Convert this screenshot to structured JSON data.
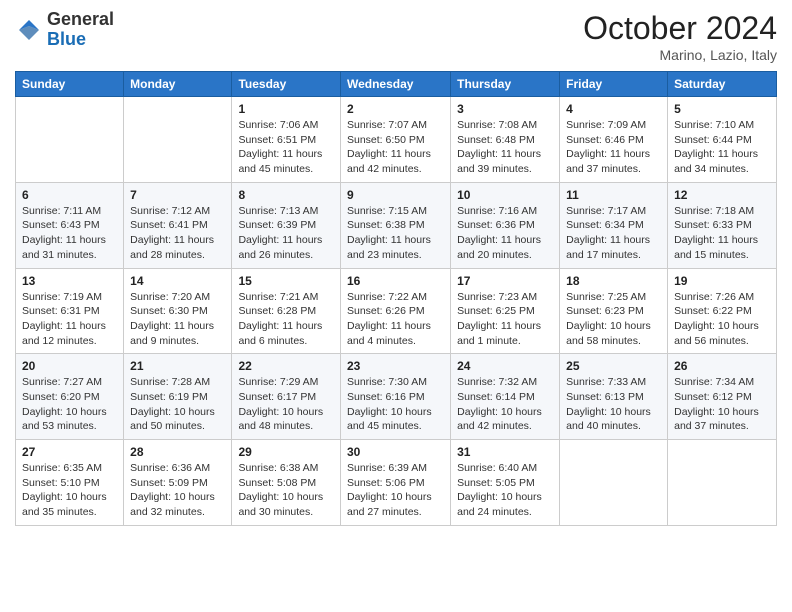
{
  "header": {
    "logo_general": "General",
    "logo_blue": "Blue",
    "month_title": "October 2024",
    "location": "Marino, Lazio, Italy"
  },
  "days_of_week": [
    "Sunday",
    "Monday",
    "Tuesday",
    "Wednesday",
    "Thursday",
    "Friday",
    "Saturday"
  ],
  "weeks": [
    [
      {
        "day": "",
        "info": ""
      },
      {
        "day": "",
        "info": ""
      },
      {
        "day": "1",
        "info": "Sunrise: 7:06 AM\nSunset: 6:51 PM\nDaylight: 11 hours and 45 minutes."
      },
      {
        "day": "2",
        "info": "Sunrise: 7:07 AM\nSunset: 6:50 PM\nDaylight: 11 hours and 42 minutes."
      },
      {
        "day": "3",
        "info": "Sunrise: 7:08 AM\nSunset: 6:48 PM\nDaylight: 11 hours and 39 minutes."
      },
      {
        "day": "4",
        "info": "Sunrise: 7:09 AM\nSunset: 6:46 PM\nDaylight: 11 hours and 37 minutes."
      },
      {
        "day": "5",
        "info": "Sunrise: 7:10 AM\nSunset: 6:44 PM\nDaylight: 11 hours and 34 minutes."
      }
    ],
    [
      {
        "day": "6",
        "info": "Sunrise: 7:11 AM\nSunset: 6:43 PM\nDaylight: 11 hours and 31 minutes."
      },
      {
        "day": "7",
        "info": "Sunrise: 7:12 AM\nSunset: 6:41 PM\nDaylight: 11 hours and 28 minutes."
      },
      {
        "day": "8",
        "info": "Sunrise: 7:13 AM\nSunset: 6:39 PM\nDaylight: 11 hours and 26 minutes."
      },
      {
        "day": "9",
        "info": "Sunrise: 7:15 AM\nSunset: 6:38 PM\nDaylight: 11 hours and 23 minutes."
      },
      {
        "day": "10",
        "info": "Sunrise: 7:16 AM\nSunset: 6:36 PM\nDaylight: 11 hours and 20 minutes."
      },
      {
        "day": "11",
        "info": "Sunrise: 7:17 AM\nSunset: 6:34 PM\nDaylight: 11 hours and 17 minutes."
      },
      {
        "day": "12",
        "info": "Sunrise: 7:18 AM\nSunset: 6:33 PM\nDaylight: 11 hours and 15 minutes."
      }
    ],
    [
      {
        "day": "13",
        "info": "Sunrise: 7:19 AM\nSunset: 6:31 PM\nDaylight: 11 hours and 12 minutes."
      },
      {
        "day": "14",
        "info": "Sunrise: 7:20 AM\nSunset: 6:30 PM\nDaylight: 11 hours and 9 minutes."
      },
      {
        "day": "15",
        "info": "Sunrise: 7:21 AM\nSunset: 6:28 PM\nDaylight: 11 hours and 6 minutes."
      },
      {
        "day": "16",
        "info": "Sunrise: 7:22 AM\nSunset: 6:26 PM\nDaylight: 11 hours and 4 minutes."
      },
      {
        "day": "17",
        "info": "Sunrise: 7:23 AM\nSunset: 6:25 PM\nDaylight: 11 hours and 1 minute."
      },
      {
        "day": "18",
        "info": "Sunrise: 7:25 AM\nSunset: 6:23 PM\nDaylight: 10 hours and 58 minutes."
      },
      {
        "day": "19",
        "info": "Sunrise: 7:26 AM\nSunset: 6:22 PM\nDaylight: 10 hours and 56 minutes."
      }
    ],
    [
      {
        "day": "20",
        "info": "Sunrise: 7:27 AM\nSunset: 6:20 PM\nDaylight: 10 hours and 53 minutes."
      },
      {
        "day": "21",
        "info": "Sunrise: 7:28 AM\nSunset: 6:19 PM\nDaylight: 10 hours and 50 minutes."
      },
      {
        "day": "22",
        "info": "Sunrise: 7:29 AM\nSunset: 6:17 PM\nDaylight: 10 hours and 48 minutes."
      },
      {
        "day": "23",
        "info": "Sunrise: 7:30 AM\nSunset: 6:16 PM\nDaylight: 10 hours and 45 minutes."
      },
      {
        "day": "24",
        "info": "Sunrise: 7:32 AM\nSunset: 6:14 PM\nDaylight: 10 hours and 42 minutes."
      },
      {
        "day": "25",
        "info": "Sunrise: 7:33 AM\nSunset: 6:13 PM\nDaylight: 10 hours and 40 minutes."
      },
      {
        "day": "26",
        "info": "Sunrise: 7:34 AM\nSunset: 6:12 PM\nDaylight: 10 hours and 37 minutes."
      }
    ],
    [
      {
        "day": "27",
        "info": "Sunrise: 6:35 AM\nSunset: 5:10 PM\nDaylight: 10 hours and 35 minutes."
      },
      {
        "day": "28",
        "info": "Sunrise: 6:36 AM\nSunset: 5:09 PM\nDaylight: 10 hours and 32 minutes."
      },
      {
        "day": "29",
        "info": "Sunrise: 6:38 AM\nSunset: 5:08 PM\nDaylight: 10 hours and 30 minutes."
      },
      {
        "day": "30",
        "info": "Sunrise: 6:39 AM\nSunset: 5:06 PM\nDaylight: 10 hours and 27 minutes."
      },
      {
        "day": "31",
        "info": "Sunrise: 6:40 AM\nSunset: 5:05 PM\nDaylight: 10 hours and 24 minutes."
      },
      {
        "day": "",
        "info": ""
      },
      {
        "day": "",
        "info": ""
      }
    ]
  ]
}
